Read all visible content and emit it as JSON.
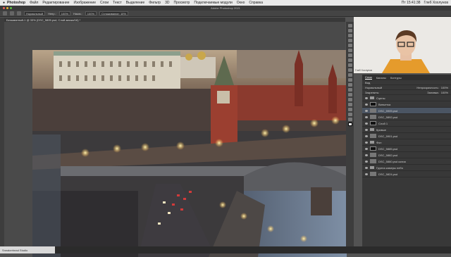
{
  "menubar": {
    "app": "Photoshop",
    "items": [
      "Файл",
      "Редактирование",
      "Изображение",
      "Слои",
      "Текст",
      "Выделение",
      "Фильтр",
      "3D",
      "Просмотр",
      "Подключаемые модули",
      "Окно",
      "Справка"
    ],
    "clock": "Пт 15:41:38",
    "user": "Глеб Хохлунов"
  },
  "window": {
    "title": "Adobe Photoshop 2021"
  },
  "options": {
    "mode": "Нормальный",
    "opacity_label": "Непр.:",
    "opacity": "100%",
    "flow_label": "Нажм.:",
    "flow": "100%",
    "smooth": "Сглаживание: 10%"
  },
  "document": {
    "tab": "Безымянный-1 @ 33% (DSC_5805.psd, Слой-маска/16) *"
  },
  "webcam": {
    "label": "Глеб Хохлунов"
  },
  "layers_panel": {
    "tabs": [
      "Слои",
      "Каналы",
      "Контуры"
    ],
    "active_tab": "Слои",
    "filter": "Вид",
    "blend": "Нормальный",
    "opacity_label": "Непрозрачность:",
    "opacity": "100%",
    "lock_label": "Закрепить:",
    "fill_label": "Заливка:",
    "fill": "100%",
    "layers": [
      {
        "name": "Сцены",
        "kind": "folder"
      },
      {
        "name": "Виньетка",
        "kind": "mask"
      },
      {
        "name": "DSC_5905.psd",
        "kind": "image",
        "selected": true
      },
      {
        "name": "DSC_5892.psd",
        "kind": "image"
      },
      {
        "name": "Слой 1",
        "kind": "mask"
      },
      {
        "name": "Кривые",
        "kind": "folder"
      },
      {
        "name": "DSC_5901.psd",
        "kind": "image"
      },
      {
        "name": "Фон",
        "kind": "folder"
      },
      {
        "name": "DSC_5885.psd",
        "kind": "mask"
      },
      {
        "name": "DSC_5882.psd",
        "kind": "image"
      },
      {
        "name": "DSC_5880.psd копия",
        "kind": "image"
      },
      {
        "name": "Группа камеры небо",
        "kind": "folder"
      },
      {
        "name": "DSC_5824.psd",
        "kind": "image"
      }
    ]
  },
  "status": {
    "zoom": "33,33%",
    "info": "Sneakerhead Studio"
  },
  "colors": {
    "accent": "#5a7bb7",
    "ui_dark": "#383838"
  }
}
